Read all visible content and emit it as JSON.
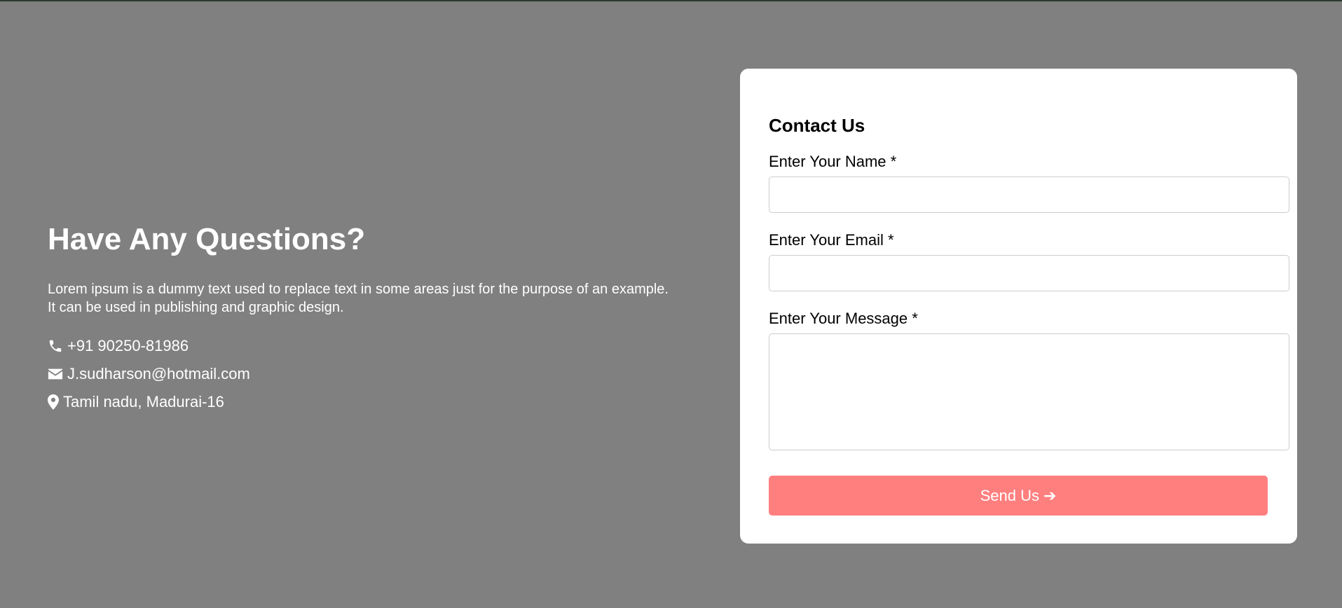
{
  "hero": {
    "title": "Have Any Questions?",
    "description": "Lorem ipsum is a dummy text used to replace text in some areas just for the purpose of an example. It can be used in publishing and graphic design.",
    "phone": "+91 90250-81986",
    "email": "J.sudharson@hotmail.com",
    "address": "Tamil nadu, Madurai-16",
    "phone_icon": "phone-icon",
    "email_icon": "envelope-icon",
    "address_icon": "map-marker-icon"
  },
  "form": {
    "title": "Contact Us",
    "name_label": "Enter Your Name *",
    "name_value": "",
    "email_label": "Enter Your Email *",
    "email_value": "",
    "message_label": "Enter Your Message *",
    "message_value": "",
    "submit_label": "Send Us",
    "submit_arrow": "➔",
    "submit_color": "#ff7f7f"
  },
  "colors": {
    "background": "#808080",
    "card": "#ffffff",
    "text_light": "#ffffff"
  }
}
